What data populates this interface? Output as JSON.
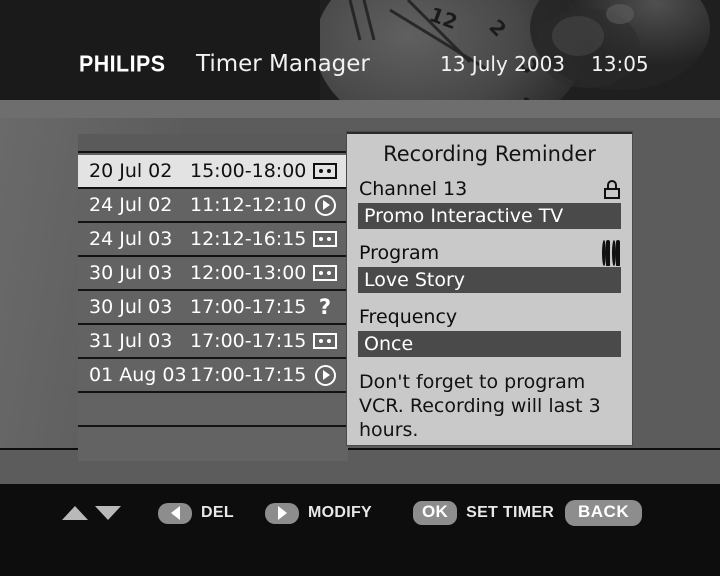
{
  "header": {
    "brand": "PHILIPS",
    "title": "Timer Manager",
    "date": "13 July 2003",
    "time": "13:05"
  },
  "timer_list": {
    "rows": [
      {
        "date": "20 Jul 02",
        "time": "15:00-18:00",
        "icon": "cassette-icon",
        "selected": true
      },
      {
        "date": "24 Jul 02",
        "time": "11:12-12:10",
        "icon": "play-circle-icon",
        "selected": false
      },
      {
        "date": "24 Jul 03",
        "time": "12:12-16:15",
        "icon": "cassette-icon",
        "selected": false
      },
      {
        "date": "30 Jul 03",
        "time": "12:00-13:00",
        "icon": "cassette-icon",
        "selected": false
      },
      {
        "date": "30 Jul 03",
        "time": "17:00-17:15",
        "icon": "question-mark-icon",
        "selected": false
      },
      {
        "date": "31 Jul 03",
        "time": "17:00-17:15",
        "icon": "cassette-icon",
        "selected": false
      },
      {
        "date": "01 Aug 03",
        "time": "17:00-17:15",
        "icon": "play-circle-icon",
        "selected": false
      }
    ],
    "empty_rows": 2
  },
  "panel": {
    "title": "Recording Reminder",
    "channel_label": "Channel 13",
    "channel_icon": "lock-icon",
    "channel_value": "Promo Interactive TV",
    "program_label": "Program",
    "program_icon": "two-pawns-icon",
    "program_value": "Love Story",
    "frequency_label": "Frequency",
    "frequency_value": "Once",
    "note": "Don't forget to program VCR. Recording will last 3 hours."
  },
  "toolbar": {
    "nav_up_icon": "arrow-up-icon",
    "nav_down_icon": "arrow-down-icon",
    "del_icon": "arrow-left-icon",
    "del_label": "DEL",
    "modify_icon": "arrow-right-icon",
    "modify_label": "MODIFY",
    "ok_key": "OK",
    "ok_label": "SET TIMER",
    "back_label": "BACK"
  },
  "colors": {
    "header_bg": "#1a1a1a",
    "body_bg": "#5c5c5c",
    "panel_bg": "#c9c9c9",
    "value_bg": "#4a4a4a",
    "row_bg": "#636363",
    "row_selected_bg": "#e3e3e3",
    "toolbar_bg": "#0d0d0d",
    "pill_bg": "#8d8d8d"
  }
}
